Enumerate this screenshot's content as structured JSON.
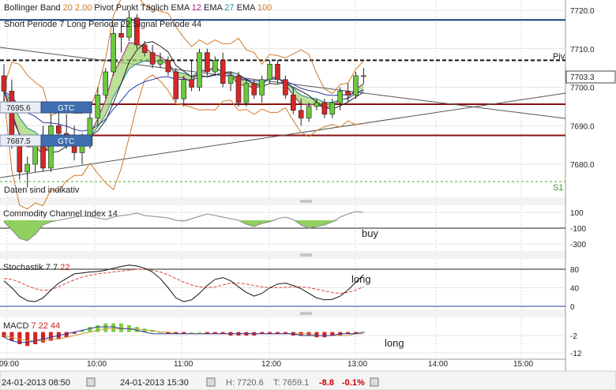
{
  "header": {
    "row1": [
      {
        "text": "Bollinger Band",
        "color": "#222222"
      },
      {
        "text": "20",
        "color": "#c77a2a"
      },
      {
        "text": "2.00",
        "color": "#c77a2a"
      },
      {
        "text": "Pivot Punkt",
        "color": "#222222"
      },
      {
        "text": "Täglich",
        "color": "#222222"
      },
      {
        "text": "EMA",
        "color": "#222222"
      },
      {
        "text": "12",
        "color": "#a0207a"
      },
      {
        "text": "EMA",
        "color": "#222222"
      },
      {
        "text": "27",
        "color": "#2a8aa0"
      },
      {
        "text": "EMA",
        "color": "#222222"
      },
      {
        "text": "100",
        "color": "#c77a2a"
      }
    ],
    "row2": [
      {
        "text": "Short Periode",
        "color": "#222222"
      },
      {
        "text": "7",
        "color": "#222222"
      },
      {
        "text": "Long Periode",
        "color": "#222222"
      },
      {
        "text": "22",
        "color": "#222222"
      },
      {
        "text": "Signal Periode",
        "color": "#222222"
      },
      {
        "text": "44",
        "color": "#222222"
      }
    ]
  },
  "orders": [
    {
      "price": "7695.6",
      "tag": "GTC"
    },
    {
      "price": "7687.5",
      "tag": "GTC"
    }
  ],
  "notice": "Daten sind indikativ",
  "pivot_label": "Piv",
  "s1_label": "S1",
  "current_price": "7703.3",
  "chart_data": [
    {
      "type": "candlestick",
      "title": "",
      "ylim": [
        7674,
        7722
      ],
      "yticks": [
        7680.0,
        7690.0,
        7700.0,
        7710.0,
        7720.0
      ],
      "ytick_labels": [
        "7680.0",
        "7690.0",
        "7700.0",
        "7710.0",
        "7720.0"
      ],
      "xticks": [
        "09:00",
        "10:00",
        "11:00",
        "12:00",
        "13:00",
        "14:00",
        "15:00"
      ],
      "levels": {
        "pivot": 7707.0,
        "s1": 7675.5,
        "resistance": 7717.5,
        "order1": 7695.6,
        "order2": 7687.5,
        "current": 7703.3
      },
      "candles": [
        [
          7703,
          7706,
          7696,
          7699
        ],
        [
          7699,
          7702,
          7684,
          7686
        ],
        [
          7686,
          7688,
          7676,
          7678
        ],
        [
          7678,
          7682,
          7674,
          7680
        ],
        [
          7680,
          7687,
          7678,
          7685
        ],
        [
          7685,
          7690,
          7678,
          7679
        ],
        [
          7679,
          7693,
          7678,
          7690
        ],
        [
          7690,
          7694,
          7685,
          7688
        ],
        [
          7688,
          7693,
          7684,
          7686
        ],
        [
          7686,
          7690,
          7681,
          7683
        ],
        [
          7683,
          7688,
          7680,
          7685
        ],
        [
          7685,
          7694,
          7684,
          7692
        ],
        [
          7692,
          7700,
          7690,
          7698
        ],
        [
          7698,
          7705,
          7697,
          7704
        ],
        [
          7704,
          7716,
          7703,
          7714
        ],
        [
          7714,
          7717,
          7709,
          7713
        ],
        [
          7713,
          7720,
          7712,
          7718
        ],
        [
          7718,
          7719,
          7710,
          7711
        ],
        [
          7711,
          7712,
          7708,
          7709
        ],
        [
          7709,
          7711,
          7705,
          7706
        ],
        [
          7706,
          7709,
          7705,
          7707
        ],
        [
          7707,
          7708,
          7703,
          7704
        ],
        [
          7704,
          7705,
          7696,
          7697
        ],
        [
          7697,
          7703,
          7695,
          7702
        ],
        [
          7702,
          7707,
          7699,
          7700
        ],
        [
          7700,
          7710,
          7699,
          7709
        ],
        [
          7709,
          7710,
          7703,
          7704
        ],
        [
          7704,
          7708,
          7703,
          7707
        ],
        [
          7707,
          7709,
          7700,
          7701
        ],
        [
          7701,
          7704,
          7699,
          7703
        ],
        [
          7703,
          7704,
          7695,
          7696
        ],
        [
          7696,
          7702,
          7695,
          7701
        ],
        [
          7701,
          7702,
          7697,
          7698
        ],
        [
          7698,
          7703,
          7696,
          7702
        ],
        [
          7702,
          7707,
          7701,
          7706
        ],
        [
          7706,
          7707,
          7701,
          7702
        ],
        [
          7702,
          7703,
          7697,
          7698
        ],
        [
          7698,
          7700,
          7693,
          7694
        ],
        [
          7694,
          7697,
          7690,
          7692
        ],
        [
          7692,
          7696,
          7691,
          7695
        ],
        [
          7695,
          7697,
          7694,
          7696
        ],
        [
          7696,
          7697,
          7692,
          7693
        ],
        [
          7693,
          7697,
          7692,
          7696
        ],
        [
          7696,
          7700,
          7694,
          7699
        ],
        [
          7699,
          7701,
          7696,
          7698
        ],
        [
          7698,
          7704,
          7697,
          7703
        ],
        [
          7703,
          7705,
          7701,
          7703
        ]
      ]
    },
    {
      "type": "area",
      "title": "Commodity Channel Index",
      "params": [
        "14"
      ],
      "ylim": [
        -330,
        120
      ],
      "yticks": [
        100,
        -100,
        -300
      ],
      "signal": "buy",
      "values": [
        -20,
        -120,
        -230,
        -260,
        -180,
        -60,
        -20,
        0,
        20,
        40,
        50,
        50,
        30,
        10,
        40,
        60,
        70,
        90,
        60,
        50,
        40,
        30,
        0,
        -10,
        20,
        50,
        80,
        60,
        40,
        20,
        0,
        -50,
        -80,
        -40,
        -20,
        20,
        40,
        10,
        -60,
        -100,
        -80,
        -60,
        -20,
        40,
        80,
        110,
        100
      ]
    },
    {
      "type": "line",
      "title": "Stochastik",
      "params": [
        "7",
        "7",
        "22"
      ],
      "ylim": [
        -5,
        90
      ],
      "yticks": [
        80,
        40,
        0
      ],
      "signal": "long",
      "k": [
        55,
        40,
        22,
        12,
        10,
        18,
        35,
        50,
        60,
        70,
        72,
        74,
        75,
        78,
        82,
        86,
        89,
        87,
        82,
        74,
        60,
        40,
        18,
        10,
        14,
        28,
        45,
        58,
        62,
        55,
        42,
        30,
        22,
        28,
        40,
        48,
        50,
        45,
        38,
        28,
        18,
        14,
        15,
        22,
        35,
        52,
        68
      ],
      "d": [
        60,
        58,
        52,
        44,
        38,
        34,
        36,
        42,
        50,
        57,
        63,
        67,
        70,
        72,
        74,
        76,
        78,
        80,
        80,
        78,
        74,
        68,
        60,
        52,
        46,
        42,
        40,
        42,
        46,
        50,
        50,
        48,
        45,
        42,
        40,
        40,
        41,
        42,
        42,
        40,
        37,
        33,
        30,
        28,
        30,
        35,
        42
      ]
    },
    {
      "type": "bar",
      "title": "MACD",
      "params": [
        "7",
        "22",
        "44"
      ],
      "ylim": [
        -12,
        6
      ],
      "yticks": [
        -2,
        -12
      ],
      "signal": "long",
      "histogram": [
        -3,
        -5,
        -7,
        -8,
        -7,
        -6,
        -5,
        -4,
        -3,
        -1,
        1,
        3,
        4,
        5,
        5,
        5,
        4,
        3,
        2,
        1,
        0,
        -1,
        -1,
        -1,
        0,
        0,
        -1,
        -1,
        -1,
        -2,
        -2,
        -2,
        -2,
        -1,
        -1,
        -1,
        -1,
        -2,
        -2,
        -2,
        -3,
        -3,
        -2,
        -2,
        -1,
        -1,
        0
      ],
      "macd": [
        -3,
        -5,
        -6,
        -6,
        -5,
        -4,
        -3,
        -2,
        -1,
        0,
        1,
        2,
        3,
        3,
        3,
        2,
        2,
        1,
        0,
        -1,
        -1,
        -1,
        -1,
        -1,
        -1,
        -1,
        -1,
        -1,
        -1,
        -1,
        -1,
        -1,
        -1,
        -1,
        -1,
        -1,
        -1,
        -1,
        -2,
        -2,
        -2,
        -2,
        -2,
        -1,
        -1,
        -1,
        0
      ],
      "signal_line": [
        -2,
        -3,
        -4,
        -5,
        -5,
        -5,
        -4,
        -4,
        -3,
        -2,
        -1,
        0,
        1,
        2,
        2,
        2,
        2,
        2,
        1,
        1,
        0,
        0,
        -1,
        -1,
        -1,
        -1,
        -1,
        -1,
        -1,
        -1,
        -1,
        -1,
        -1,
        -1,
        -1,
        -1,
        -1,
        -1,
        -1,
        -1,
        -2,
        -2,
        -2,
        -2,
        -2,
        -1,
        -1
      ]
    }
  ],
  "footer": {
    "start": "24-01-2013 08:50",
    "end": "24-01-2013 15:30",
    "high": "H: 7720.6",
    "low": "T: 7659.1",
    "change": "-8.8",
    "change_pct": "-0.1%",
    "change_color": "#cc0000"
  }
}
